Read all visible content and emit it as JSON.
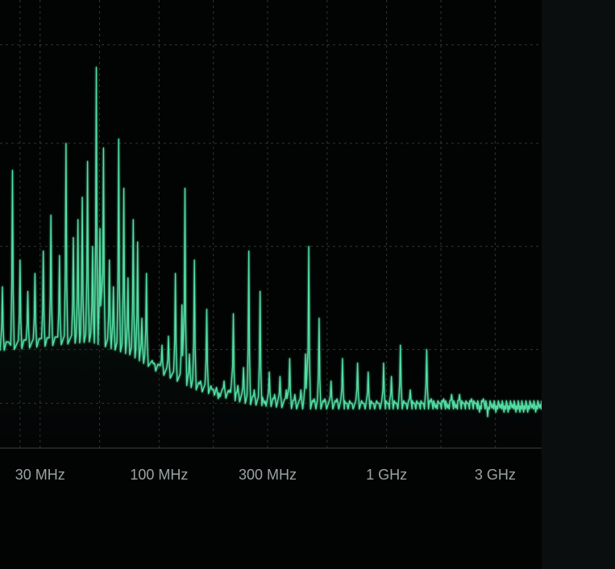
{
  "colors": {
    "background": "#020303",
    "side_panel": "#0b0e0e",
    "trace": "#52e0a4",
    "grid": "#4f5a56",
    "tick_text": "#9aa3a3"
  },
  "chart_data": {
    "type": "line",
    "title": "",
    "xlabel": "",
    "ylabel": "",
    "x_scale": "log",
    "xlim_hz": [
      20000000,
      4800000000
    ],
    "ylim": [
      0,
      100
    ],
    "grid": true,
    "legend": "none",
    "x_ticks": [
      {
        "value": 30000000,
        "label": "30 MHz"
      },
      {
        "value": 100000000,
        "label": "100 MHz"
      },
      {
        "value": 300000000,
        "label": "300 MHz"
      },
      {
        "value": 1000000000,
        "label": "1 GHz"
      },
      {
        "value": 3000000000,
        "label": "3 GHz"
      }
    ],
    "y_grid": [
      10,
      22,
      45,
      68,
      90
    ],
    "noise_floor": [
      [
        20000000,
        23
      ],
      [
        50000000,
        25
      ],
      [
        75000000,
        22
      ],
      [
        100000000,
        18
      ],
      [
        150000000,
        14
      ],
      [
        250000000,
        11
      ],
      [
        400000000,
        10
      ],
      [
        1000000000,
        10
      ],
      [
        4800000000,
        10
      ]
    ],
    "peaks": [
      [
        20500000,
        36
      ],
      [
        22700000,
        62
      ],
      [
        24500000,
        42
      ],
      [
        26500000,
        35
      ],
      [
        28500000,
        39
      ],
      [
        31000000,
        44
      ],
      [
        33500000,
        52
      ],
      [
        36500000,
        43
      ],
      [
        39000000,
        68
      ],
      [
        42000000,
        47
      ],
      [
        44000000,
        51
      ],
      [
        46000000,
        56
      ],
      [
        48500000,
        64
      ],
      [
        51000000,
        45
      ],
      [
        53000000,
        85
      ],
      [
        55000000,
        49
      ],
      [
        57000000,
        67
      ],
      [
        60500000,
        42
      ],
      [
        63000000,
        36
      ],
      [
        66500000,
        69
      ],
      [
        70000000,
        58
      ],
      [
        73000000,
        38
      ],
      [
        77000000,
        51
      ],
      [
        80500000,
        46
      ],
      [
        84000000,
        29
      ],
      [
        88000000,
        39
      ],
      [
        95000000,
        19
      ],
      [
        103000000,
        23
      ],
      [
        110000000,
        25
      ],
      [
        118000000,
        39
      ],
      [
        126000000,
        32
      ],
      [
        130000000,
        58
      ],
      [
        136000000,
        21
      ],
      [
        143000000,
        42
      ],
      [
        152000000,
        15
      ],
      [
        162000000,
        31
      ],
      [
        172000000,
        13
      ],
      [
        182000000,
        11
      ],
      [
        193000000,
        15
      ],
      [
        205000000,
        13
      ],
      [
        212000000,
        30
      ],
      [
        222000000,
        14
      ],
      [
        235000000,
        18
      ],
      [
        248000000,
        44
      ],
      [
        262000000,
        13
      ],
      [
        278000000,
        35
      ],
      [
        290000000,
        10
      ],
      [
        305000000,
        17
      ],
      [
        322000000,
        12
      ],
      [
        340000000,
        16
      ],
      [
        362000000,
        13
      ],
      [
        375000000,
        20
      ],
      [
        395000000,
        12
      ],
      [
        420000000,
        13
      ],
      [
        440000000,
        21
      ],
      [
        455000000,
        45
      ],
      [
        480000000,
        11
      ],
      [
        505000000,
        29
      ],
      [
        535000000,
        11
      ],
      [
        570000000,
        15
      ],
      [
        605000000,
        11
      ],
      [
        640000000,
        20
      ],
      [
        665000000,
        10
      ],
      [
        700000000,
        10
      ],
      [
        745000000,
        19
      ],
      [
        790000000,
        10
      ],
      [
        830000000,
        17
      ],
      [
        870000000,
        10
      ],
      [
        920000000,
        10
      ],
      [
        970000000,
        19
      ],
      [
        1010000000,
        10
      ],
      [
        1050000000,
        16
      ],
      [
        1100000000,
        10
      ],
      [
        1150000000,
        23
      ],
      [
        1210000000,
        10
      ],
      [
        1270000000,
        13
      ],
      [
        1320000000,
        10
      ],
      [
        1380000000,
        10
      ],
      [
        1440000000,
        10
      ],
      [
        1500000000,
        22
      ],
      [
        1570000000,
        11
      ],
      [
        1640000000,
        9
      ],
      [
        1710000000,
        10
      ],
      [
        1780000000,
        11
      ],
      [
        1850000000,
        9
      ],
      [
        1930000000,
        12
      ],
      [
        2010000000,
        9
      ],
      [
        2090000000,
        12
      ],
      [
        2180000000,
        10
      ],
      [
        2270000000,
        10
      ],
      [
        2360000000,
        11
      ],
      [
        2460000000,
        10
      ],
      [
        2560000000,
        8
      ],
      [
        2660000000,
        11
      ],
      [
        2780000000,
        7
      ],
      [
        2900000000,
        9
      ],
      [
        3020000000,
        8
      ],
      [
        3150000000,
        9
      ],
      [
        3280000000,
        8
      ],
      [
        3420000000,
        8
      ],
      [
        3560000000,
        9
      ],
      [
        3700000000,
        8
      ],
      [
        3850000000,
        8
      ],
      [
        4000000000,
        8
      ],
      [
        4170000000,
        8
      ],
      [
        4340000000,
        9
      ],
      [
        4520000000,
        8
      ],
      [
        4700000000,
        9
      ]
    ]
  }
}
